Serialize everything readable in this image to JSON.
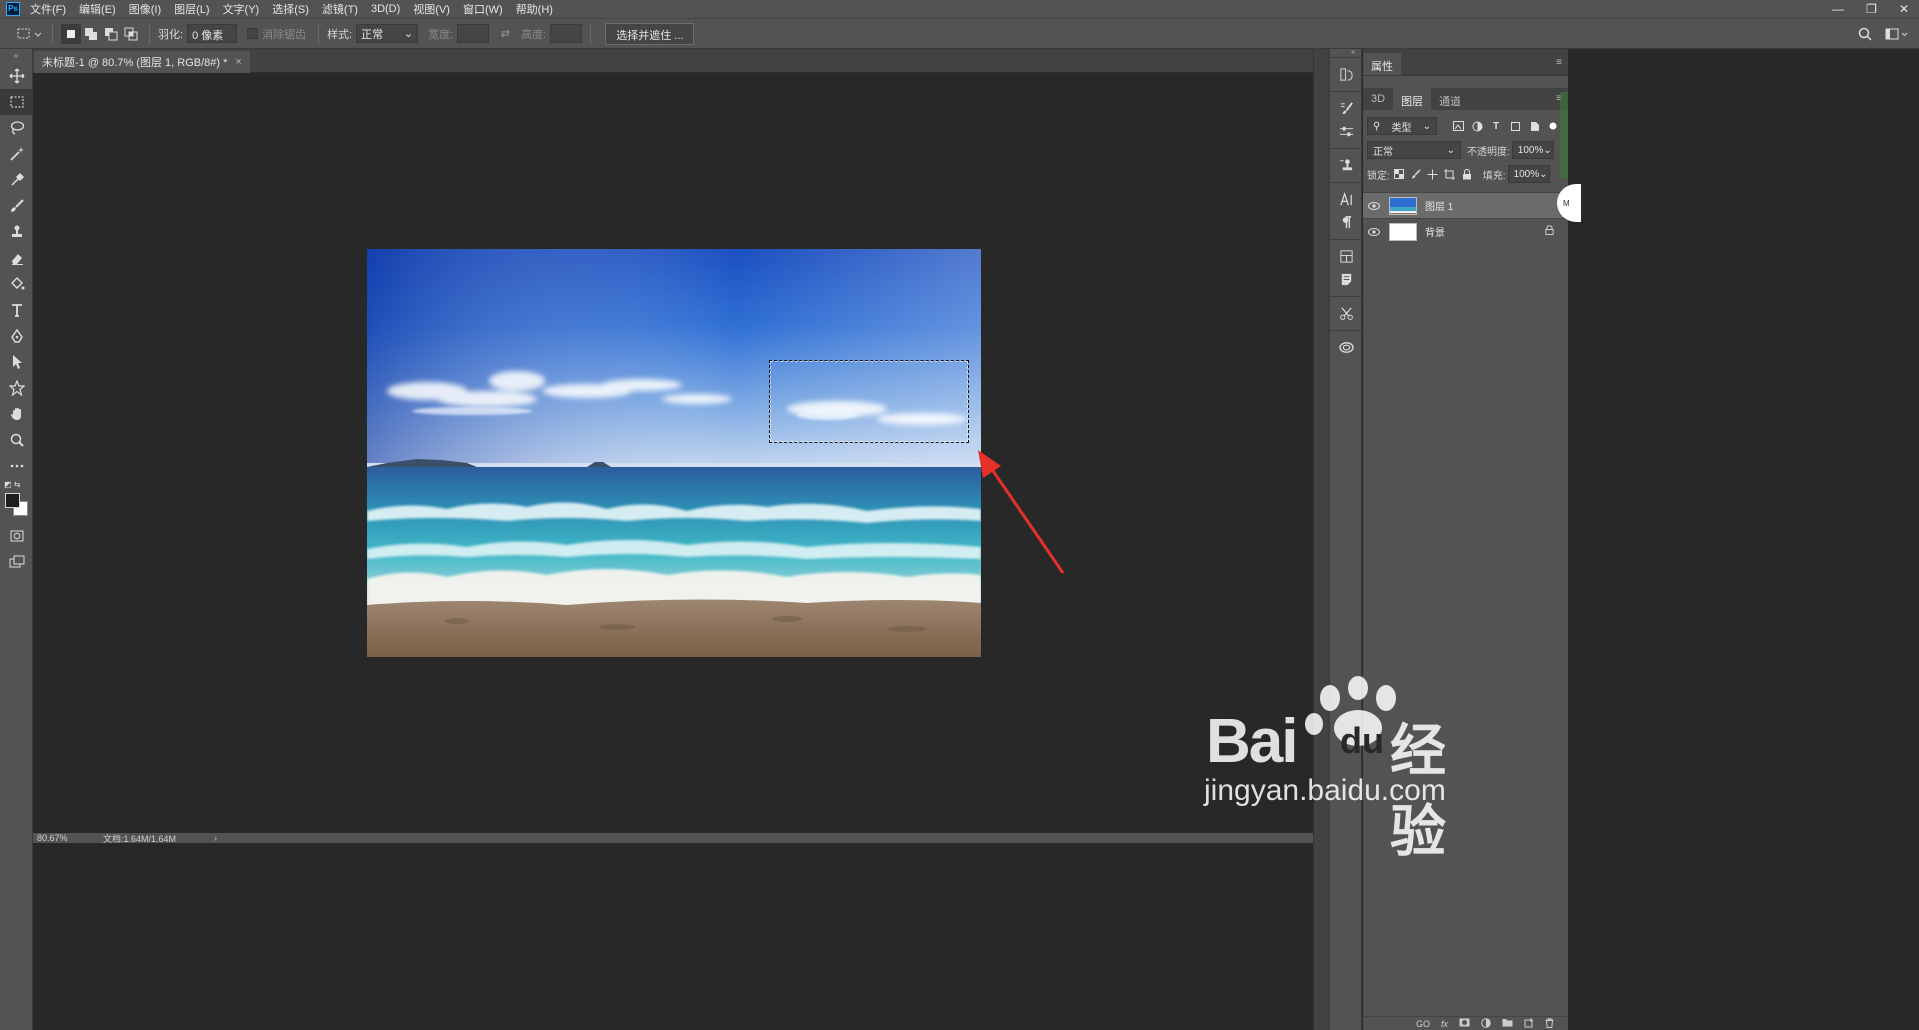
{
  "menubar": {
    "logo": "Ps",
    "items": [
      "文件(F)",
      "编辑(E)",
      "图像(I)",
      "图层(L)",
      "文字(Y)",
      "选择(S)",
      "滤镜(T)",
      "3D(D)",
      "视图(V)",
      "窗口(W)",
      "帮助(H)"
    ],
    "window_controls": {
      "minimize": "—",
      "restore": "❐",
      "close": "✕"
    }
  },
  "options": {
    "feather_label": "羽化:",
    "feather_value": "0 像素",
    "antialias_label": "消除锯齿",
    "style_label": "样式:",
    "style_value": "正常",
    "width_label": "宽度:",
    "height_label": "高度:",
    "select_mask_button": "选择并遮住 ..."
  },
  "document": {
    "tab_title": "未标题-1 @ 80.7% (图层 1, RGB/8#) *",
    "close": "×",
    "zoom": "80.67%",
    "doc_info": "文档:1.64M/1.64M",
    "more": "›"
  },
  "properties_panel": {
    "title": "属性"
  },
  "layers_panel": {
    "tabs": [
      "3D",
      "图层",
      "通道"
    ],
    "active_tab": "图层",
    "filter_kind": "类型",
    "blend_mode": "正常",
    "opacity_label": "不透明度:",
    "opacity_value": "100%",
    "lock_label": "锁定:",
    "fill_label": "填充:",
    "fill_value": "100%",
    "layers": [
      {
        "name": "图层 1",
        "selected": true,
        "visible": true,
        "locked": false
      },
      {
        "name": "背景",
        "selected": false,
        "visible": true,
        "locked": true
      }
    ],
    "footer_icons": [
      "link-icon",
      "fx-icon",
      "mask-icon",
      "adjustment-icon",
      "folder-icon",
      "new-layer-icon",
      "trash-icon"
    ],
    "footer_labels": {
      "link": "GO",
      "fx": "fx"
    }
  },
  "float_badge": "M",
  "watermark": {
    "main": "Bai",
    "paw_text": "du",
    "cn": "经验",
    "sub": "jingyan.baidu.com"
  },
  "colors": {
    "ui_bg": "#535353",
    "canvas_bg": "#282828",
    "annotation_arrow": "#e8302a"
  }
}
